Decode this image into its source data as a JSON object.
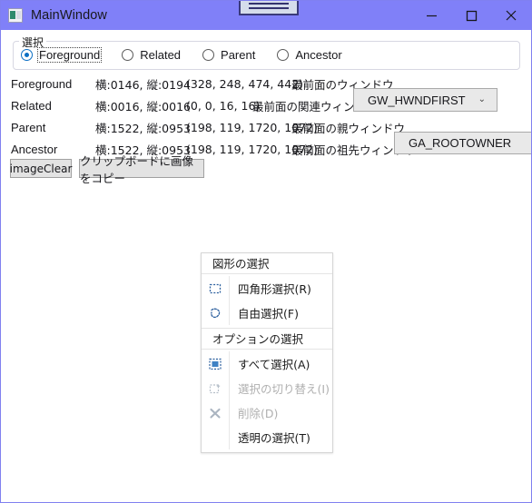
{
  "window": {
    "title": "MainWindow",
    "app_icon": "window-image-icon",
    "titlebar_color": "#8080f8",
    "controls": {
      "minimize": "minimize-icon",
      "maximize": "maximize-icon",
      "close": "close-icon"
    },
    "overlay_handle": "drag-handle-widget"
  },
  "groupbox": {
    "label": "選択",
    "radios": [
      {
        "label": "Foreground",
        "checked": true,
        "focused": true
      },
      {
        "label": "Related",
        "checked": false,
        "focused": false
      },
      {
        "label": "Parent",
        "checked": false,
        "focused": false
      },
      {
        "label": "Ancestor",
        "checked": false,
        "focused": false
      }
    ]
  },
  "rows": [
    {
      "name": "Foreground",
      "size": "横:0146, 縦:0194",
      "rect": "(328, 248, 474, 442)",
      "desc": "最前面のウィンドウ",
      "combo": null
    },
    {
      "name": "Related",
      "size": "横:0016, 縦:0016",
      "rect": "(0, 0, 16, 16)",
      "desc": "最前面の関連ウィンドウ",
      "combo": "GW_HWNDFIRST"
    },
    {
      "name": "Parent",
      "size": "横:1522, 縦:0953",
      "rect": "(198, 119, 1720, 1072)",
      "desc": "最前面の親ウィンドウ",
      "combo": null
    },
    {
      "name": "Ancestor",
      "size": "横:1522, 縦:0953",
      "rect": "(198, 119, 1720, 1072)",
      "desc": "最前面の祖先ウィンドウ",
      "combo": "GA_ROOTOWNER"
    }
  ],
  "buttons": {
    "image_clear": "imageClear",
    "copy_clipboard": "クリップボードに画像をコピー"
  },
  "context_menu": {
    "sections": [
      {
        "header": "図形の選択",
        "items": [
          {
            "label": "四角形選択(R)",
            "icon": "rect-select-icon",
            "disabled": false
          },
          {
            "label": "自由選択(F)",
            "icon": "lasso-select-icon",
            "disabled": false
          }
        ]
      },
      {
        "header": "オプションの選択",
        "items": [
          {
            "label": "すべて選択(A)",
            "icon": "select-all-icon",
            "disabled": false
          },
          {
            "label": "選択の切り替え(I)",
            "icon": "invert-select-icon",
            "disabled": true
          },
          {
            "label": "削除(D)",
            "icon": "delete-x-icon",
            "disabled": true
          },
          {
            "label": "透明の選択(T)",
            "icon": "none-icon",
            "disabled": false
          }
        ]
      }
    ]
  }
}
